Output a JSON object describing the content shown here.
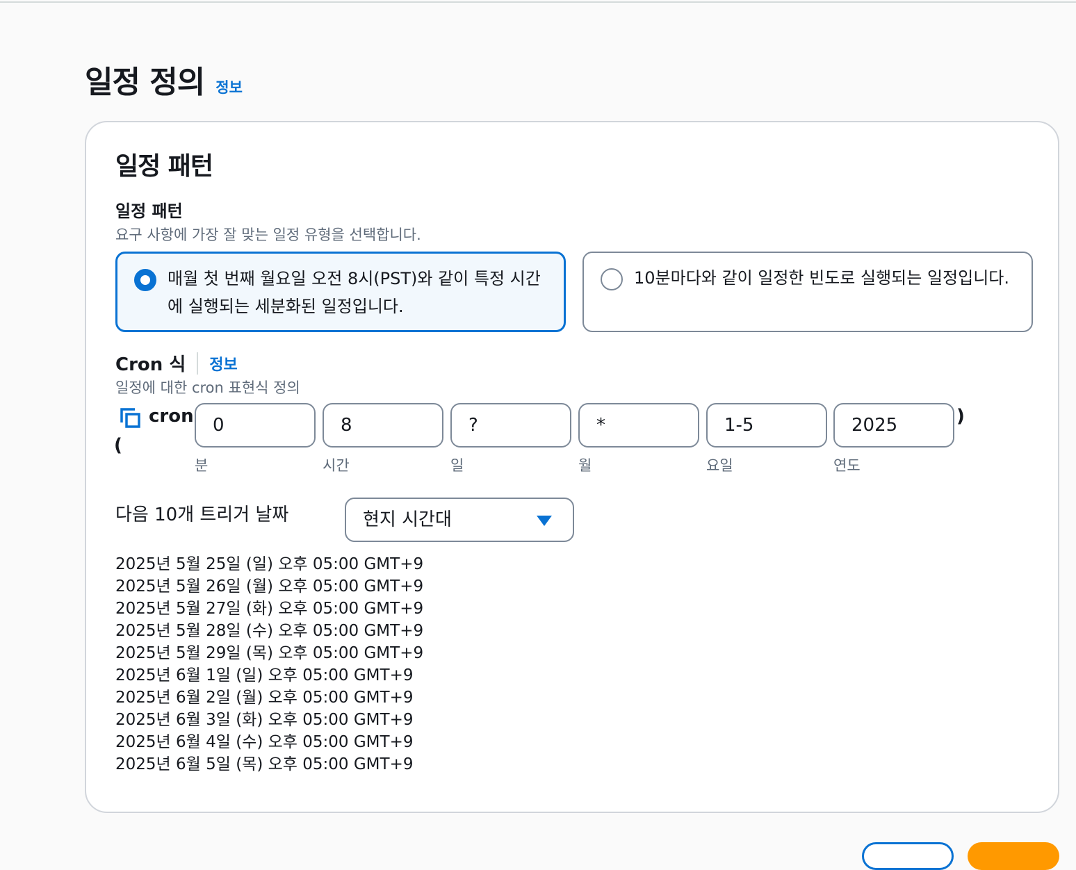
{
  "page": {
    "title": "일정 정의",
    "info_label": "정보"
  },
  "pattern_section": {
    "title": "일정 패턴",
    "field_label": "일정 패턴",
    "field_description": "요구 사항에 가장 잘 맞는 일정 유형을 선택합니다.",
    "options": [
      {
        "label": "매월 첫 번째 월요일 오전 8시(PST)와 같이 특정 시간에 실행되는 세분화된 일정입니다.",
        "selected": true
      },
      {
        "label": "10분마다와 같이 일정한 빈도로 실행되는 일정입니다.",
        "selected": false
      }
    ]
  },
  "cron": {
    "label": "Cron 식",
    "info_label": "정보",
    "description": "일정에 대한 cron 표현식 정의",
    "prefix": "cron",
    "open_paren": "(",
    "close_paren": ")",
    "fields": [
      {
        "value": "0",
        "label": "분"
      },
      {
        "value": "8",
        "label": "시간"
      },
      {
        "value": "?",
        "label": "일"
      },
      {
        "value": "*",
        "label": "월"
      },
      {
        "value": "1-5",
        "label": "요일"
      },
      {
        "value": "2025",
        "label": "연도"
      }
    ]
  },
  "triggers": {
    "label": "다음 10개 트리거 날짜",
    "timezone_selected": "현지 시간대",
    "dates": [
      "2025년 5월 25일 (일) 오후 05:00 GMT+9",
      "2025년 5월 26일 (월) 오후 05:00 GMT+9",
      "2025년 5월 27일 (화) 오후 05:00 GMT+9",
      "2025년 5월 28일 (수) 오후 05:00 GMT+9",
      "2025년 5월 29일 (목) 오후 05:00 GMT+9",
      "2025년 6월 1일 (일) 오후 05:00 GMT+9",
      "2025년 6월 2일 (월) 오후 05:00 GMT+9",
      "2025년 6월 3일 (화) 오후 05:00 GMT+9",
      "2025년 6월 4일 (수) 오후 05:00 GMT+9",
      "2025년 6월 5일 (목) 오후 05:00 GMT+9"
    ]
  },
  "colors": {
    "accent": "#0972d3",
    "primary_button": "#ff9900",
    "text": "#16191f",
    "muted_text": "#5f6b7a"
  },
  "icons": {
    "copy": "copy-icon",
    "dropdown": "caret-down-icon"
  }
}
